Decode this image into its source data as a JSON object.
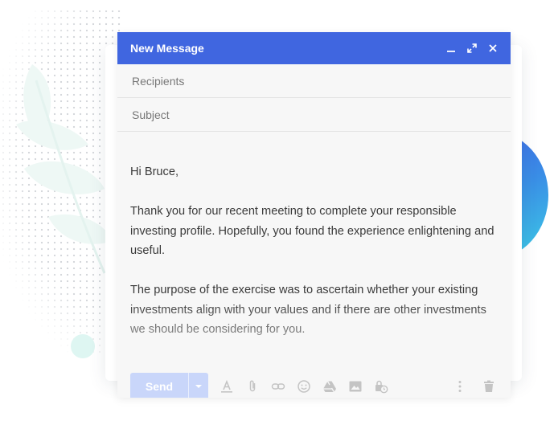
{
  "compose": {
    "title": "New Message",
    "recipients_placeholder": "Recipients",
    "subject_placeholder": "Subject",
    "body": {
      "greeting": "Hi Bruce,",
      "paragraph1": "Thank you for our recent meeting to complete your responsible investing profile. Hopefully, you found the experience enlightening and useful.",
      "paragraph2": "The purpose of the exercise was to ascertain whether your existing investments align with your values and if there are other investments we should be considering for you."
    },
    "send_label": "Send"
  },
  "colors": {
    "titlebar": "#4066e0",
    "send_button": "#c9d6fa",
    "accent_circle_start": "#3f5fe6",
    "accent_circle_end": "#3ccbe6"
  },
  "icons": {
    "window_controls": [
      "minimize-icon",
      "expand-icon",
      "close-icon"
    ],
    "toolbar": [
      "text-format-icon",
      "attach-icon",
      "link-icon",
      "emoji-icon",
      "drive-icon",
      "image-icon",
      "lock-clock-icon",
      "more-vert-icon",
      "trash-icon"
    ]
  }
}
